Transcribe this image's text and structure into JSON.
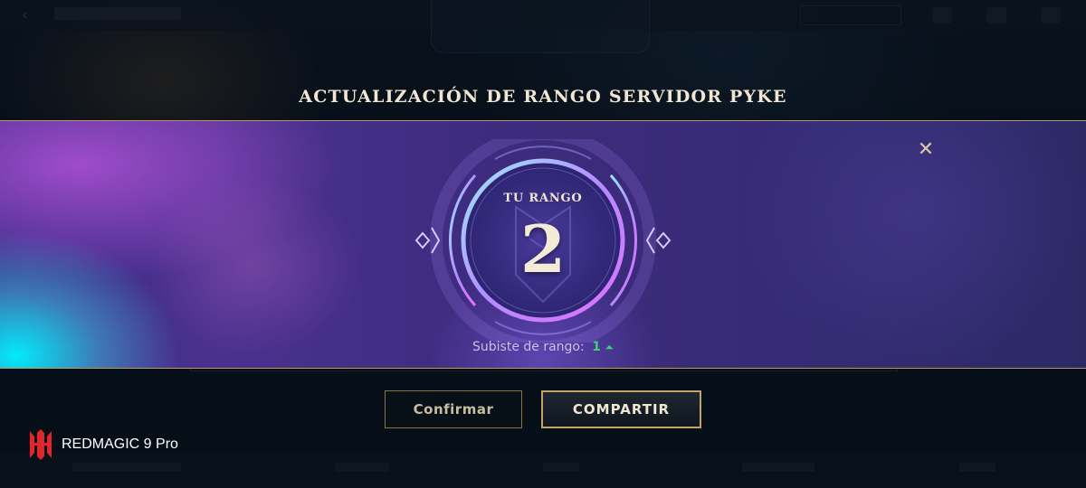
{
  "dialog": {
    "title": "ACTUALIZACIÓN DE RANGO SERVIDOR PYKE",
    "rank_label": "TU RANGO",
    "rank_value": "2",
    "rank_change_label": "Subiste de rango:",
    "rank_change_value": "1",
    "close_icon": "close-icon"
  },
  "buttons": {
    "confirm_label": "Confirmar",
    "share_label": "COMPARTIR"
  },
  "watermark": {
    "text": "REDMAGIC 9 Pro"
  },
  "colors": {
    "gold": "#c2a468",
    "title_text": "#f0e6d2",
    "rank_up_green": "#3fd07a",
    "banner_purple": "#3d2c7e",
    "cyan_glow": "#00f0ff"
  }
}
